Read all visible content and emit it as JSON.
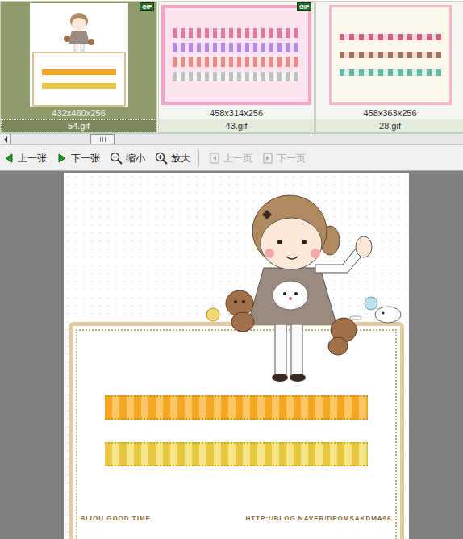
{
  "thumbnails": [
    {
      "file": "54.gif",
      "info": "432x460x256",
      "badge": "GIF",
      "selected": true
    },
    {
      "file": "43.gif",
      "info": "458x314x256",
      "badge": "GIF",
      "selected": false
    },
    {
      "file": "28.gif",
      "info": "458x363x256",
      "selected": false
    }
  ],
  "scrollbar": {
    "position": 0.19
  },
  "toolbar": [
    {
      "label": "上一张",
      "kind": "prev",
      "disabled": false
    },
    {
      "label": "下一张",
      "kind": "next",
      "disabled": false
    },
    {
      "label": "缩小",
      "kind": "zoom-out",
      "disabled": false
    },
    {
      "label": "放大",
      "kind": "zoom-in",
      "disabled": false
    },
    {
      "label": "上一页",
      "kind": "page-prev",
      "disabled": true
    },
    {
      "label": "下一页",
      "kind": "page-next",
      "disabled": true
    }
  ],
  "viewer": {
    "footer_left": "BIJOU GOOD TIME",
    "footer_right": "HTTP://BLOG.NAVER/DPOMSAKDMA96"
  }
}
